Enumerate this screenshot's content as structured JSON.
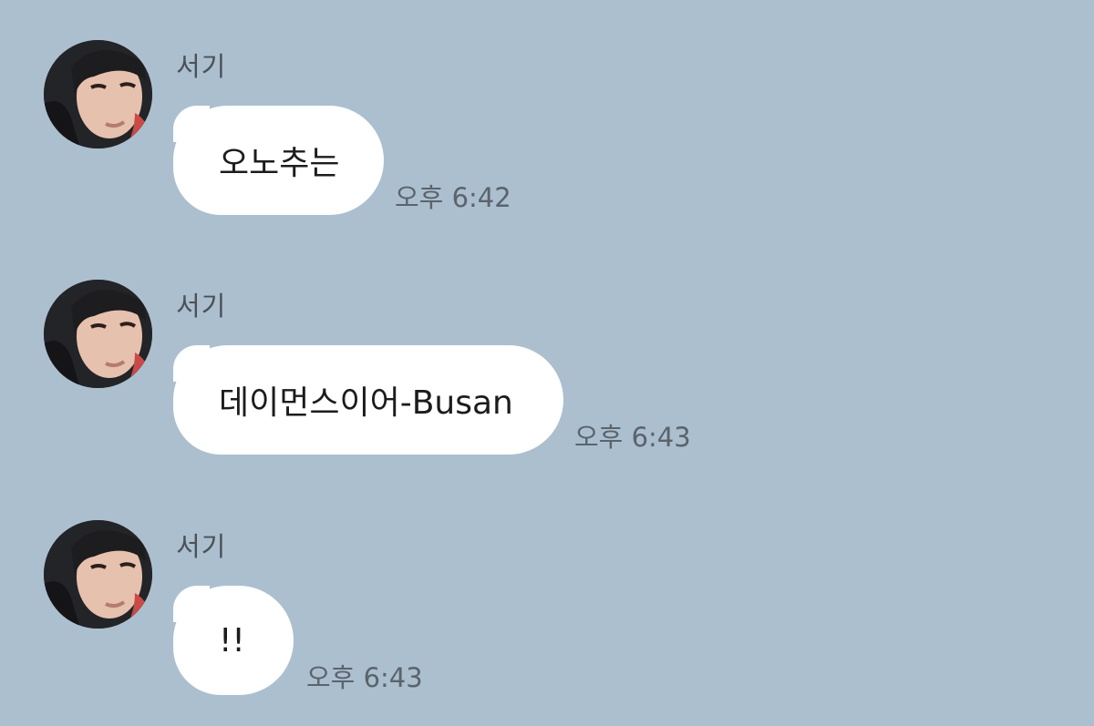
{
  "messages": [
    {
      "sender": "서기",
      "text": "오노추는",
      "time": "오후 6:42"
    },
    {
      "sender": "서기",
      "text": "데이먼스이어-Busan",
      "time": "오후 6:43"
    },
    {
      "sender": "서기",
      "text": "!!",
      "time": "오후 6:43"
    }
  ],
  "colors": {
    "background": "#abbfcf",
    "bubble": "#ffffff",
    "sender_text": "#4b5157",
    "time_text": "#5b636b"
  },
  "icons": {
    "avatar": "profile-photo"
  }
}
